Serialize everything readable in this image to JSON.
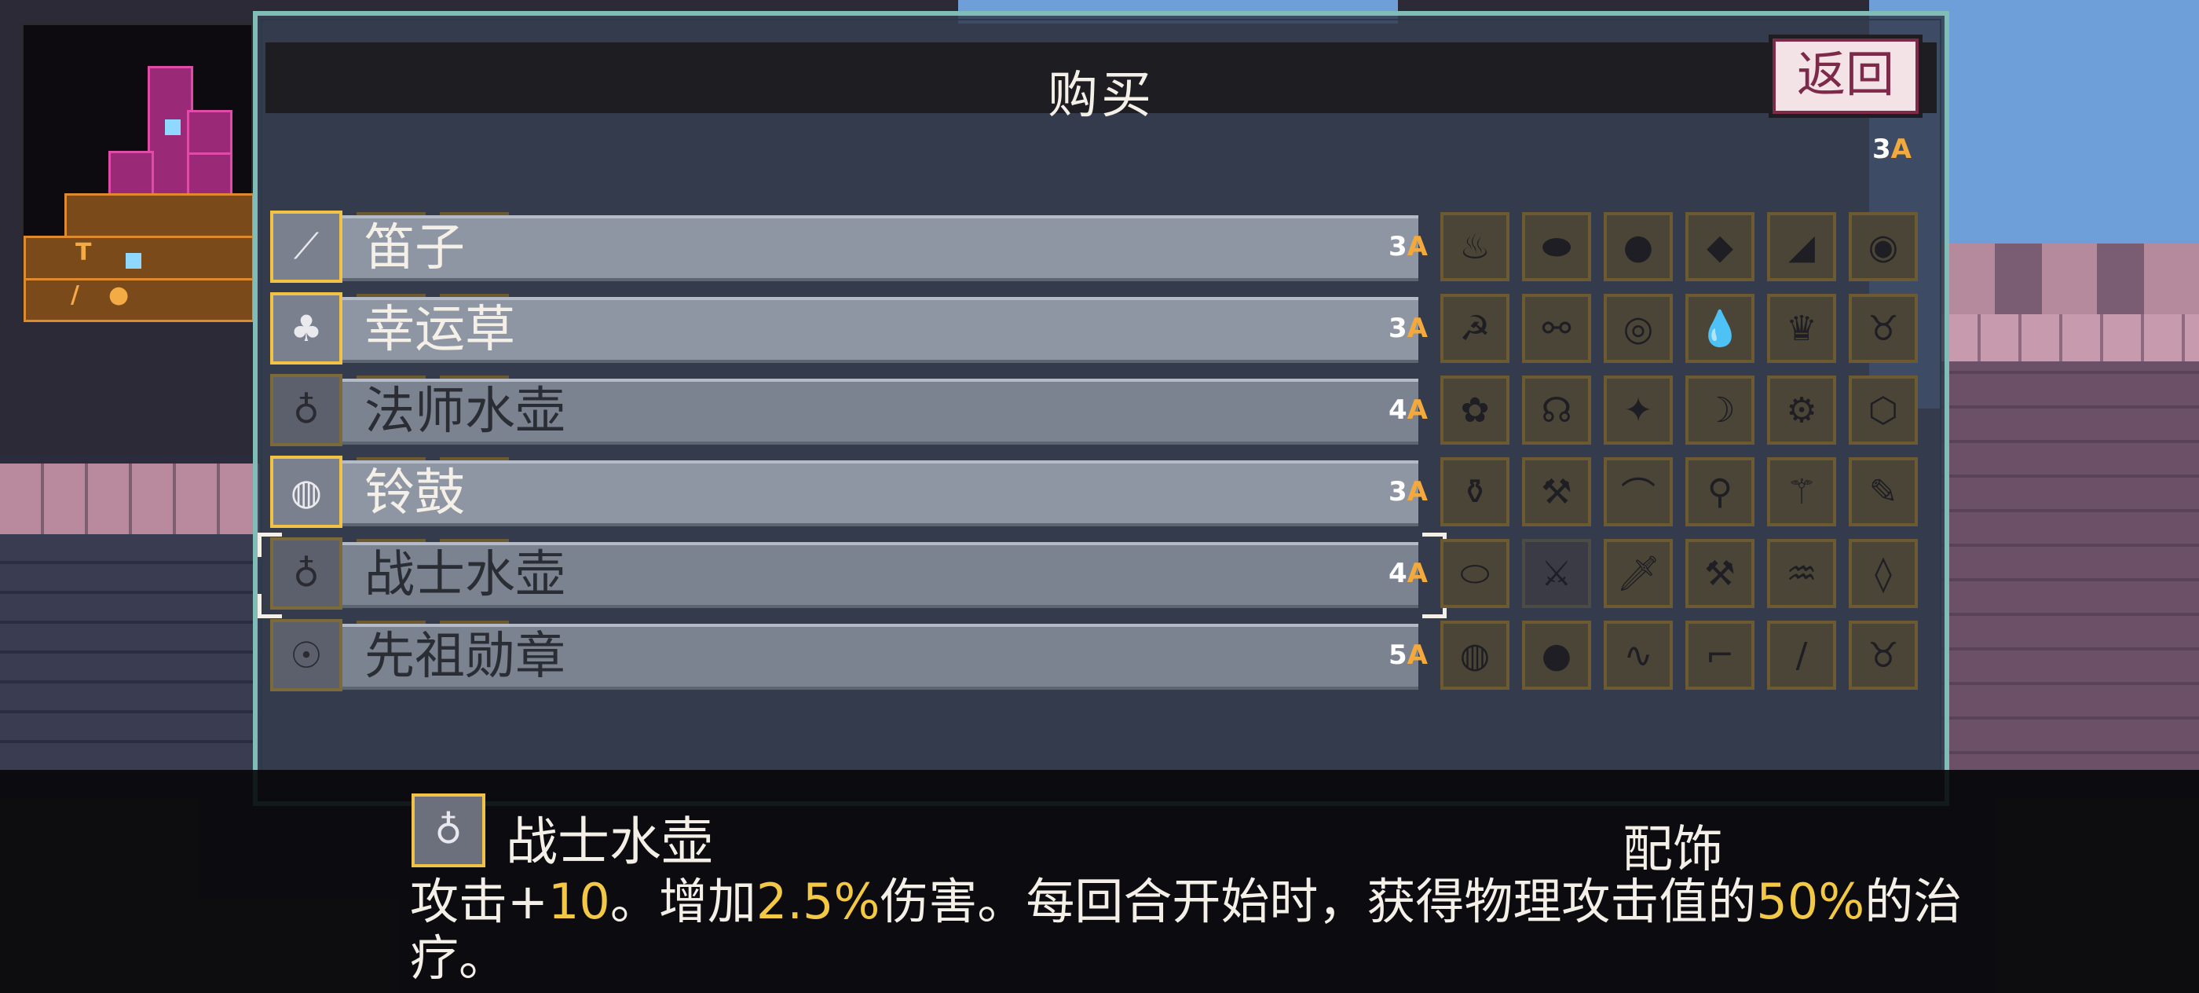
{
  "shop": {
    "title": "购买",
    "back_label": "返回",
    "gold_amount": "3",
    "gold_unit": "A"
  },
  "items": [
    {
      "name": "笛子",
      "price": "3",
      "unit": "A",
      "affordable": true,
      "icon": "flute-icon"
    },
    {
      "name": "幸运草",
      "price": "3",
      "unit": "A",
      "affordable": true,
      "icon": "clover-icon"
    },
    {
      "name": "法师水壶",
      "price": "4",
      "unit": "A",
      "affordable": false,
      "icon": "flask-icon"
    },
    {
      "name": "铃鼓",
      "price": "3",
      "unit": "A",
      "affordable": true,
      "icon": "tambourine-icon"
    },
    {
      "name": "战士水壶",
      "price": "4",
      "unit": "A",
      "affordable": false,
      "icon": "warrior-flask-icon"
    },
    {
      "name": "先祖勋章",
      "price": "5",
      "unit": "A",
      "affordable": false,
      "icon": "medal-icon"
    }
  ],
  "details": {
    "name": "战士水壶",
    "category": "配饰",
    "desc_1": "攻击+",
    "desc_2": "10",
    "desc_3": "。增加",
    "desc_4": "2.5%",
    "desc_5": "伤害。每回合开始时，获得物理攻击值的",
    "desc_6": "50%",
    "desc_7": "的治疗。"
  },
  "colors": {
    "accent_gold": "#f0c246",
    "panel_border": "#7fbdb6",
    "back_button_text": "#7d2a4a"
  }
}
